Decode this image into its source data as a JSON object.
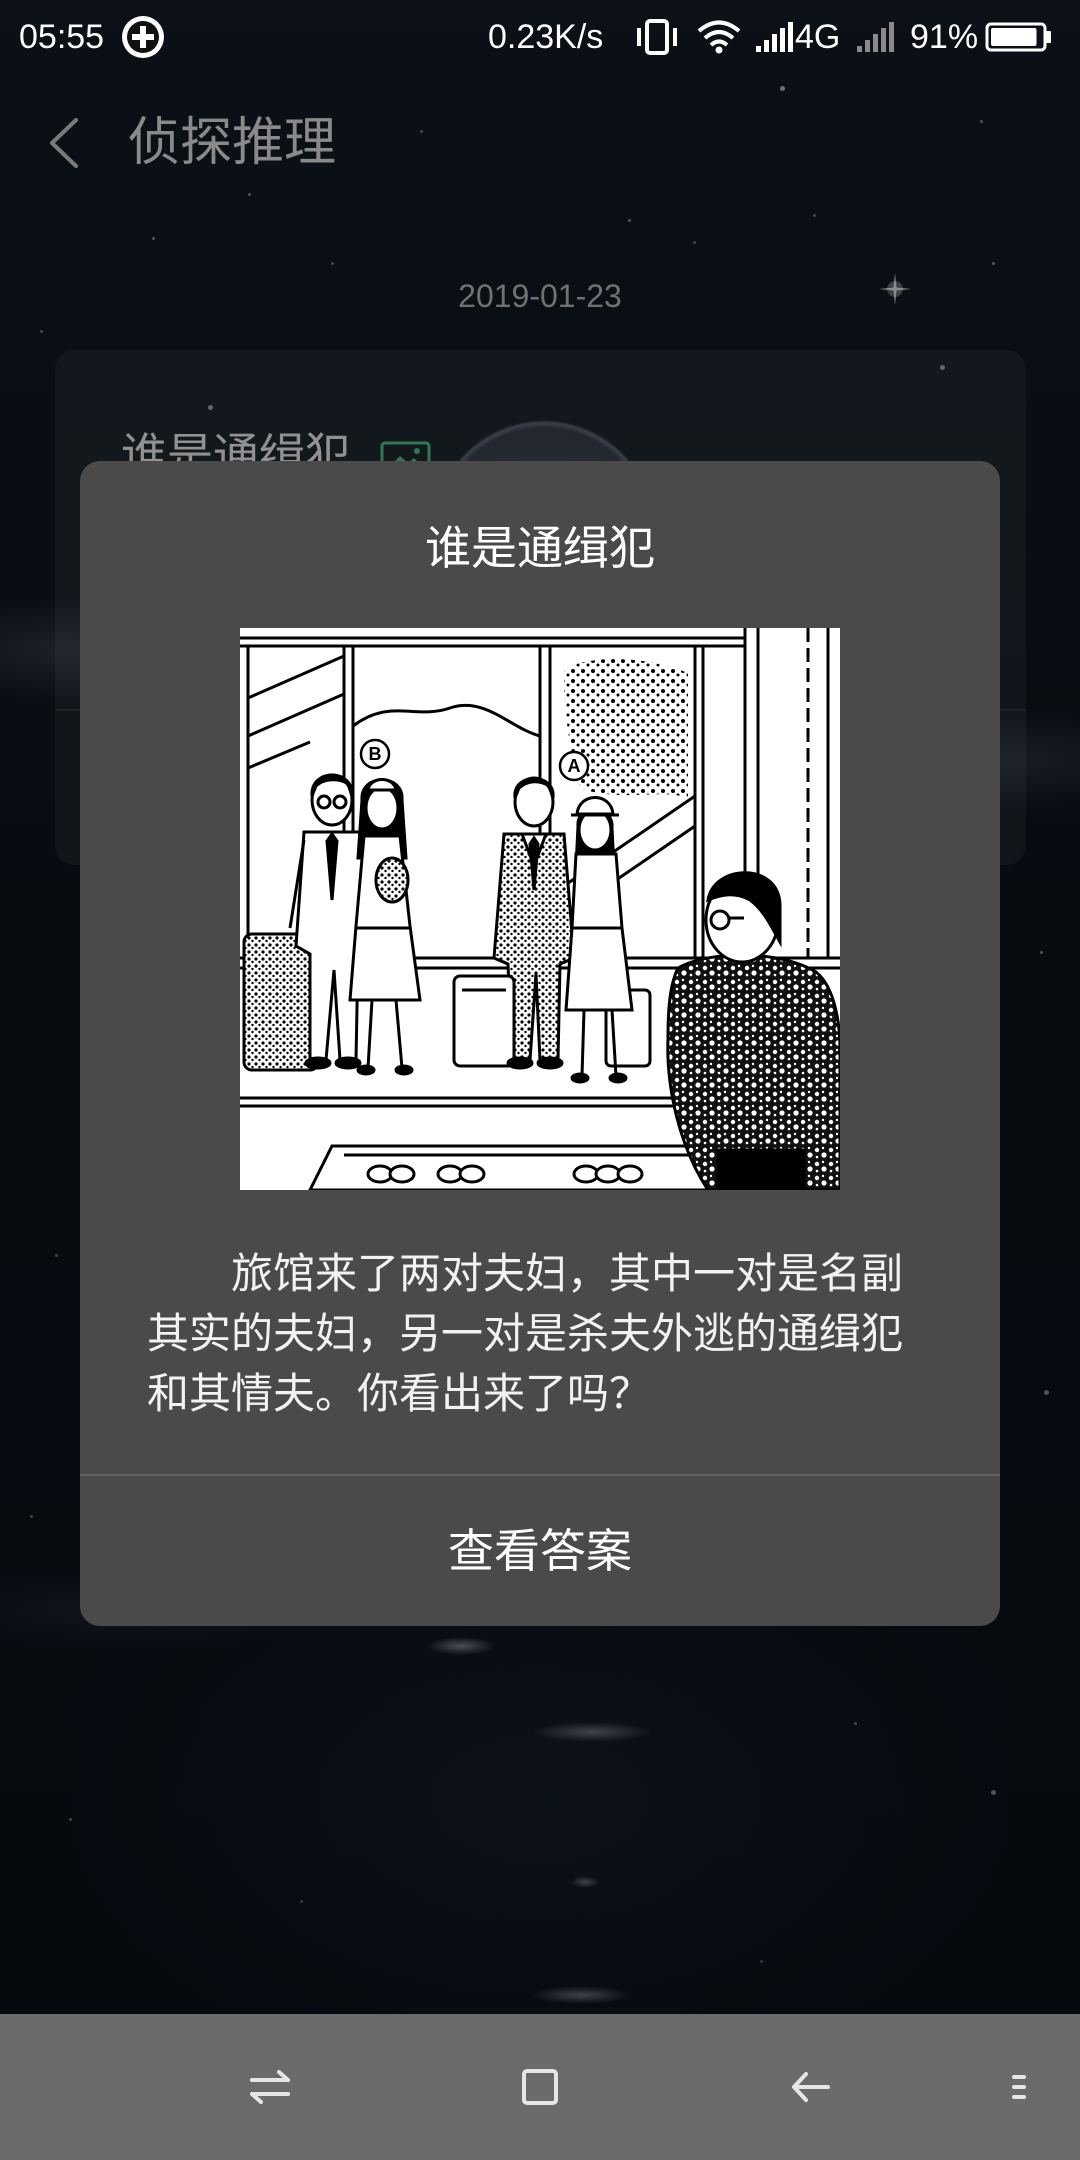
{
  "colors": {
    "background": "#0b1018",
    "dialog": "#4a4a4a",
    "nav_bar": "#6b6b6b",
    "accent_green": "#4fc98a",
    "text_primary": "#ffffff"
  },
  "status_bar": {
    "time": "05:55",
    "network_speed": "0.23K/s",
    "network_type": "4G",
    "battery_level": "91%",
    "battery_fraction": 0.91,
    "icons": {
      "notification": "circle-plus-icon",
      "vibrate": "vibrate-icon",
      "wifi": "wifi-icon",
      "signal_primary": "signal-bars-icon",
      "signal_secondary": "signal-bars-empty-icon",
      "battery": "battery-icon"
    }
  },
  "header": {
    "back_icon": "chevron-left-icon",
    "title": "侦探推理"
  },
  "feed": {
    "date": "2019-01-23",
    "card": {
      "title": "谁是通缉犯",
      "title_icon": "image-icon"
    }
  },
  "dialog": {
    "title": "谁是通缉犯",
    "illustration": {
      "labels": [
        "B",
        "A"
      ]
    },
    "body": "旅馆来了两对夫妇，其中一对是名副其实的夫妇，另一对是杀夫外逃的通缉犯和其情夫。你看出来了吗？",
    "action_label": "查看答案"
  },
  "nav_bar": {
    "icons": [
      "recents-switch-icon",
      "home-square-icon",
      "back-arrow-icon",
      "menu-icon"
    ]
  }
}
